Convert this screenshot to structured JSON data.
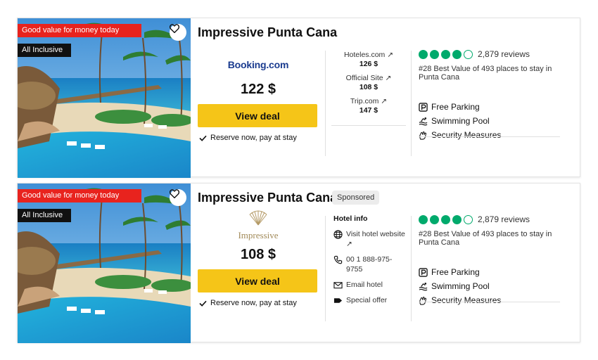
{
  "listings": [
    {
      "badge_value": "Good value for money today",
      "badge_inclusive": "All Inclusive",
      "name": "Impressive Punta Cana",
      "provider_logo": "Booking.com",
      "price": "122 $",
      "deal_button": "View deal",
      "reserve_text": "Reserve now, pay at stay",
      "other_prices": [
        {
          "name": "Hoteles.com ↗",
          "price": "126 $"
        },
        {
          "name": "Official Site ↗",
          "price": "108 $"
        },
        {
          "name": "Trip.com ↗",
          "price": "147 $"
        }
      ],
      "rating_bubbles": 4,
      "reviews": "2,879 reviews",
      "rank": "#28 Best Value of 493 places to stay in Punta Cana",
      "amenities": [
        "Free Parking",
        "Swimming Pool",
        "Security Measures"
      ]
    },
    {
      "badge_value": "Good value for money today",
      "badge_inclusive": "All Inclusive",
      "name": "Impressive Punta Cana",
      "sponsored": "Sponsored",
      "provider_logo": "Impressive",
      "price": "108 $",
      "deal_button": "View deal",
      "reserve_text": "Reserve now, pay at stay",
      "hotel_info": {
        "title": "Hotel info",
        "visit": "Visit hotel website ↗",
        "phone": "00 1 888-975-9755",
        "email": "Email hotel",
        "offer": "Special offer"
      },
      "rating_bubbles": 4,
      "reviews": "2,879 reviews",
      "rank": "#28 Best Value of 493 places to stay in Punta Cana",
      "amenities": [
        "Free Parking",
        "Swimming Pool",
        "Security Measures"
      ]
    }
  ],
  "colors": {
    "value_badge": "#e8231e",
    "deal_button": "#f5c518",
    "rating": "#00aa6c"
  },
  "icons": [
    "heart-icon",
    "check-icon",
    "external-link-icon",
    "parking-icon",
    "pool-icon",
    "security-icon",
    "globe-icon",
    "phone-icon",
    "email-icon",
    "tag-icon"
  ]
}
